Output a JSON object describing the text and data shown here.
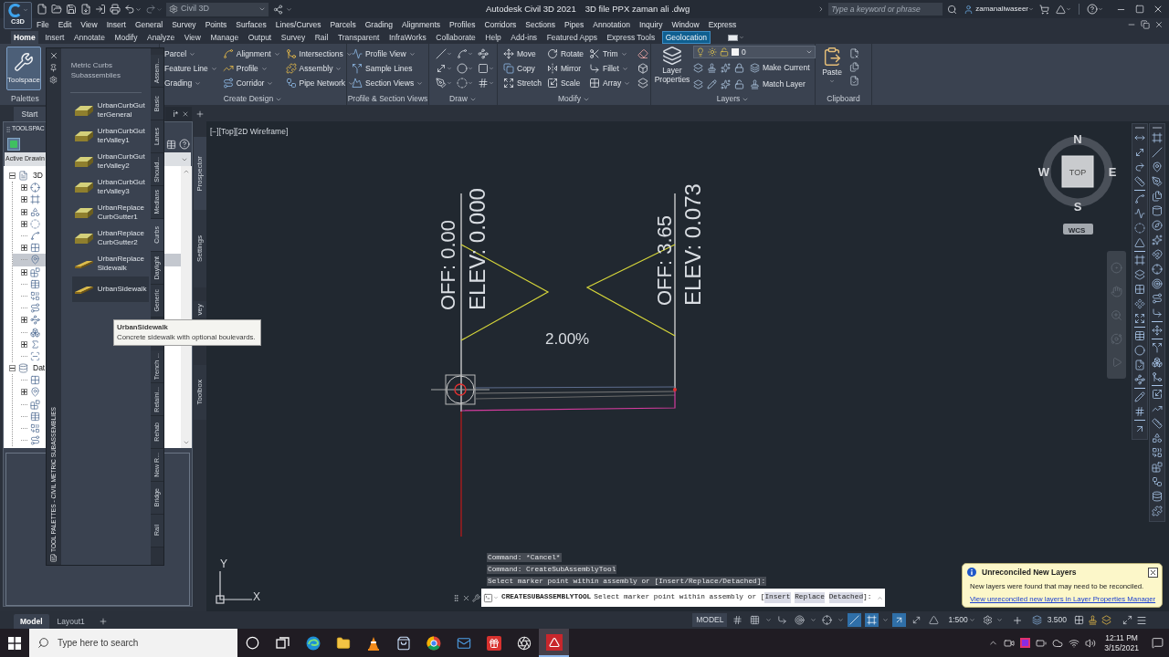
{
  "title_bar": {
    "app_label": "C3D",
    "workspace": "Civil 3D",
    "app_title": "Autodesk Civil 3D 2021",
    "file_name": "3D file PPX zaman ali .dwg",
    "search": {
      "placeholder": "Type a keyword or phrase"
    },
    "user": "zamanaliwaseer"
  },
  "menu_bar": [
    "File",
    "Edit",
    "View",
    "Insert",
    "General",
    "Survey",
    "Points",
    "Surfaces",
    "Lines/Curves",
    "Parcels",
    "Grading",
    "Alignments",
    "Profiles",
    "Corridors",
    "Sections",
    "Pipes",
    "Annotation",
    "Inquiry",
    "Window",
    "Express"
  ],
  "ribbon_tabs": [
    {
      "label": "Home",
      "selected": true,
      "contextual": false
    },
    {
      "label": "Insert",
      "selected": false,
      "contextual": false
    },
    {
      "label": "Annotate",
      "selected": false,
      "contextual": false
    },
    {
      "label": "Modify",
      "selected": false,
      "contextual": false
    },
    {
      "label": "Analyze",
      "selected": false,
      "contextual": false
    },
    {
      "label": "View",
      "selected": false,
      "contextual": false
    },
    {
      "label": "Manage",
      "selected": false,
      "contextual": false
    },
    {
      "label": "Output",
      "selected": false,
      "contextual": false
    },
    {
      "label": "Survey",
      "selected": false,
      "contextual": false
    },
    {
      "label": "Rail",
      "selected": false,
      "contextual": false
    },
    {
      "label": "Transparent",
      "selected": false,
      "contextual": false
    },
    {
      "label": "InfraWorks",
      "selected": false,
      "contextual": false
    },
    {
      "label": "Collaborate",
      "selected": false,
      "contextual": false
    },
    {
      "label": "Help",
      "selected": false,
      "contextual": false
    },
    {
      "label": "Add-ins",
      "selected": false,
      "contextual": false
    },
    {
      "label": "Featured Apps",
      "selected": false,
      "contextual": false
    },
    {
      "label": "Express Tools",
      "selected": false,
      "contextual": false
    },
    {
      "label": "Geolocation",
      "selected": false,
      "contextual": true
    }
  ],
  "ribbon_panels": [
    {
      "kind": "palettes",
      "title": "Palettes",
      "button": {
        "label": "Toolspace",
        "on": true
      }
    },
    {
      "kind": "list",
      "title": "Create Design",
      "menu": true,
      "columns": [
        [
          {
            "label": "Parcel",
            "menu": true
          },
          {
            "label": "Feature Line",
            "menu": true
          },
          {
            "label": "Grading",
            "menu": true
          }
        ],
        [
          {
            "label": "Alignment",
            "menu": true
          },
          {
            "label": "Profile",
            "menu": true
          },
          {
            "label": "Corridor",
            "menu": true
          }
        ],
        [
          {
            "label": "Intersections",
            "menu": true
          },
          {
            "label": "Assembly",
            "menu": true
          },
          {
            "label": "Pipe Network",
            "menu": true
          }
        ]
      ]
    },
    {
      "kind": "list",
      "title": "Profile & Section Views",
      "menu": false,
      "columns": [
        [
          {
            "label": "Profile View",
            "menu": true
          },
          {
            "label": "Sample Lines",
            "menu": false
          },
          {
            "label": "Section Views",
            "menu": true
          }
        ]
      ]
    },
    {
      "kind": "draw",
      "title": "Draw",
      "menu": true
    },
    {
      "kind": "list",
      "title": "Modify",
      "menu": true,
      "columns": [
        [
          {
            "label": "Move",
            "menu": false
          },
          {
            "label": "Copy",
            "menu": false
          },
          {
            "label": "Stretch",
            "menu": false
          }
        ],
        [
          {
            "label": "Rotate",
            "menu": false
          },
          {
            "label": "Mirror",
            "menu": false
          },
          {
            "label": "Scale",
            "menu": false
          }
        ],
        [
          {
            "label": "Trim",
            "menu": true
          },
          {
            "label": "Fillet",
            "menu": true
          },
          {
            "label": "Array",
            "menu": true
          }
        ]
      ]
    },
    {
      "kind": "layers",
      "title": "Layers",
      "menu": true,
      "button": {
        "label": "Layer Properties"
      },
      "layer": "0",
      "actions": [
        "Make Current",
        "Match Layer"
      ]
    },
    {
      "kind": "clipboard",
      "title": "Clipboard",
      "menu": false,
      "button": {
        "label": "Paste"
      }
    }
  ],
  "file_tabs": [
    {
      "label": "Start",
      "selected": false
    },
    {
      "label": "i*",
      "selected": true
    }
  ],
  "toolspace": {
    "title": "TOOLSPAC",
    "view": "Active Drawin",
    "tree": [
      {
        "label": "3D",
        "expanded": true,
        "selected": false,
        "children": [
          {
            "collapsed": true,
            "selected": false
          },
          {
            "collapsed": true,
            "selected": false
          },
          {
            "collapsed": true,
            "selected": false
          },
          {
            "collapsed": true,
            "selected": false
          },
          {
            "collapsed": false,
            "selected": false
          },
          {
            "collapsed": true,
            "selected": false
          },
          {
            "collapsed": false,
            "selected": true
          },
          {
            "collapsed": true,
            "selected": false
          },
          {
            "collapsed": false,
            "selected": false
          },
          {
            "collapsed": false,
            "selected": false
          },
          {
            "collapsed": false,
            "selected": false
          },
          {
            "collapsed": true,
            "selected": false
          },
          {
            "collapsed": false,
            "selected": false
          },
          {
            "collapsed": true,
            "selected": false
          },
          {
            "collapsed": false,
            "selected": false
          }
        ]
      },
      {
        "label": "Dat",
        "expanded": true,
        "selected": false,
        "children": [
          {
            "collapsed": false,
            "selected": false
          },
          {
            "collapsed": true,
            "selected": false
          },
          {
            "collapsed": false,
            "selected": false
          },
          {
            "collapsed": false,
            "selected": false
          },
          {
            "collapsed": false,
            "selected": false
          },
          {
            "collapsed": false,
            "selected": false
          }
        ]
      }
    ],
    "side_tabs": [
      {
        "label": "Prospector",
        "selected": true
      },
      {
        "label": "Settings",
        "selected": false
      },
      {
        "label": "vey",
        "selected": false
      },
      {
        "label": "Toolbox",
        "selected": false
      }
    ]
  },
  "tool_palette": {
    "title": "Metric Curbs Subassemblies",
    "side_title": "TOOL PALETTES - CIVIL METRIC SUBASSEMBLIES",
    "tools": [
      {
        "kind": "curb",
        "lines": [
          "UrbanCurbGut",
          "terGeneral"
        ],
        "hovered": false
      },
      {
        "kind": "curb",
        "lines": [
          "UrbanCurbGut",
          "terValley1"
        ],
        "hovered": false
      },
      {
        "kind": "curb",
        "lines": [
          "UrbanCurbGut",
          "terValley2"
        ],
        "hovered": false
      },
      {
        "kind": "curb",
        "lines": [
          "UrbanCurbGut",
          "terValley3"
        ],
        "hovered": false
      },
      {
        "kind": "curb",
        "lines": [
          "UrbanReplace",
          "CurbGutter1"
        ],
        "hovered": false
      },
      {
        "kind": "curb",
        "lines": [
          "UrbanReplace",
          "CurbGutter2"
        ],
        "hovered": false
      },
      {
        "kind": "sidewalk",
        "lines": [
          "UrbanReplace",
          "Sidewalk"
        ],
        "hovered": false
      },
      {
        "kind": "sidewalk",
        "lines": [
          "UrbanSidewalk"
        ],
        "hovered": true
      }
    ],
    "tabs": [
      {
        "label": "Assem...",
        "selected": false
      },
      {
        "label": "Basic",
        "selected": false
      },
      {
        "label": "Lanes",
        "selected": false
      },
      {
        "label": "Should...",
        "selected": false
      },
      {
        "label": "Medians",
        "selected": false
      },
      {
        "label": "Curbs",
        "selected": true
      },
      {
        "label": "Daylight",
        "selected": false
      },
      {
        "label": "Generic",
        "selected": false
      },
      {
        "label": "Trench ...",
        "selected": false
      },
      {
        "label": "Retaini...",
        "selected": false
      },
      {
        "label": "Rehab",
        "selected": false
      },
      {
        "label": "New R...",
        "selected": false
      },
      {
        "label": "Bridge",
        "selected": false
      },
      {
        "label": "Rail",
        "selected": false
      }
    ]
  },
  "tooltip": {
    "title": "UrbanSidewalk",
    "description": "Concrete sidewalk with optional boulevards."
  },
  "viewport": {
    "controls": "[−][Top][2D Wireframe]",
    "offsets": [
      {
        "offset": "OFF: 0.00",
        "elevation": "ELEV: 0.000"
      },
      {
        "offset": "OFF: 3.65",
        "elevation": "ELEV: 0.073"
      }
    ],
    "grade": "2.00%",
    "view_cube": {
      "face": "TOP",
      "north": "N",
      "south": "S",
      "east": "E",
      "west": "W",
      "ucs": "WCS"
    },
    "axes": {
      "x": "X",
      "y": "Y"
    }
  },
  "command_line": {
    "history": [
      "Command: *Cancel*",
      "Command: CreateSubAssemblyTool",
      "Select marker point within assembly or [Insert/Replace/Detached]:"
    ],
    "command": "CREATESUBASSEMBLYTOOL",
    "prompt": "Select marker point within assembly or [",
    "options": [
      "Insert",
      "Replace",
      "Detached"
    ],
    "prompt_end": "]:"
  },
  "notification": {
    "title": "Unreconciled New Layers",
    "message": "New layers were found that may need to be reconciled.",
    "link": "View unreconciled new layers in Layer Properties Manager"
  },
  "layout_tabs": [
    {
      "label": "Model",
      "selected": true
    },
    {
      "label": "Layout1",
      "selected": false
    }
  ],
  "status_bar": {
    "space": "MODEL",
    "toggles": [
      {
        "on": false
      },
      {
        "on": false
      },
      {
        "on": false
      },
      {
        "on": false
      },
      {
        "on": false
      },
      {
        "on": true
      },
      {
        "on": true
      },
      {
        "on": true
      },
      {
        "on": false
      },
      {
        "on": false
      }
    ],
    "scale": "1:500",
    "readout": "3.500"
  },
  "taskbar": {
    "search": {
      "placeholder": "Type here to search"
    },
    "apps": [
      {
        "kind": "ring",
        "selected": false
      },
      {
        "kind": "task-view",
        "selected": false
      },
      {
        "kind": "browser",
        "selected": false
      },
      {
        "kind": "folder",
        "selected": false
      },
      {
        "kind": "cone",
        "selected": false
      },
      {
        "kind": "bag",
        "selected": false
      },
      {
        "kind": "wheel",
        "selected": false
      },
      {
        "kind": "mail",
        "selected": false
      },
      {
        "kind": "gift",
        "selected": false
      },
      {
        "kind": "aperture",
        "selected": false
      },
      {
        "kind": "cad",
        "selected": true
      }
    ],
    "time": "12:11 PM",
    "date": "3/15/2021"
  }
}
